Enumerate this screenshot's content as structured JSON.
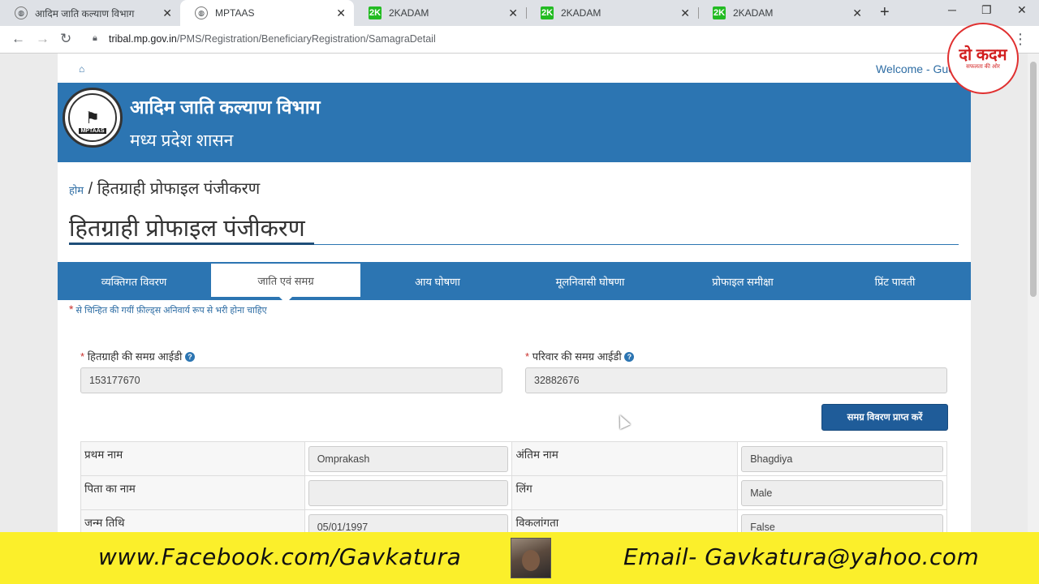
{
  "browser": {
    "tabs": [
      {
        "title": "आदिम जाति कल्याण विभाग",
        "active": false
      },
      {
        "title": "MPTAAS",
        "active": true
      },
      {
        "title": "2KADAM",
        "active": false
      },
      {
        "title": "2KADAM",
        "active": false
      },
      {
        "title": "2KADAM",
        "active": false
      }
    ],
    "favicon_badge": "2K",
    "url_domain": "tribal.mp.gov.in",
    "url_path": "/PMS/Registration/BeneficiaryRegistration/SamagraDetail"
  },
  "header": {
    "welcome": "Welcome - Gue",
    "department": "आदिम जाति कल्याण विभाग",
    "government": "मध्य प्रदेश शासन",
    "emblem_text": "MPTAAS"
  },
  "breadcrumb": {
    "home": "होम",
    "separator": " / ",
    "current": "हितग्राही प्रोफाइल पंजीकरण"
  },
  "page_title": "हितग्राही प्रोफाइल पंजीकरण",
  "steps": [
    {
      "label": "व्यक्तिगत विवरण",
      "active": false
    },
    {
      "label": "जाति एवं समग्र",
      "active": true
    },
    {
      "label": "आय घोषणा",
      "active": false
    },
    {
      "label": "मूलनिवासी घोषणा",
      "active": false
    },
    {
      "label": "प्रोफाइल समीक्षा",
      "active": false
    },
    {
      "label": "प्रिंट पावती",
      "active": false
    }
  ],
  "required_note": "से चिन्हित की गयीं फ़ील्ड्स अनिवार्य रूप से भरी होना चाहिए",
  "form": {
    "beneficiary_samagra_label": "हितग्राही की समग्र आईडी",
    "beneficiary_samagra_value": "153177670",
    "family_samagra_label": "परिवार की समग्र आईडी",
    "family_samagra_value": "32882676",
    "fetch_button": "समग्र विवरण प्राप्त करें"
  },
  "details": {
    "first_name_label": "प्रथम नाम",
    "first_name": "Omprakash",
    "last_name_label": "अंतिम नाम",
    "last_name": "Bhagdiya",
    "father_name_label": "पिता का नाम",
    "father_name": "",
    "gender_label": "लिंग",
    "gender": "Male",
    "dob_label": "जन्म तिथि",
    "dob": "05/01/1997",
    "disability_label": "विकलांगता",
    "disability": "False"
  },
  "overlay": {
    "facebook": "www.Facebook.com/Gavkatura",
    "email": "Email- Gavkatura@yahoo.com",
    "logo_mark": "दो कदम",
    "logo_sub": "सफलता की ओर"
  },
  "colors": {
    "header_blue": "#2c75b2",
    "button_blue": "#1f5c99",
    "required_red": "#c9302c",
    "overlay_yellow": "#fbef2b"
  }
}
